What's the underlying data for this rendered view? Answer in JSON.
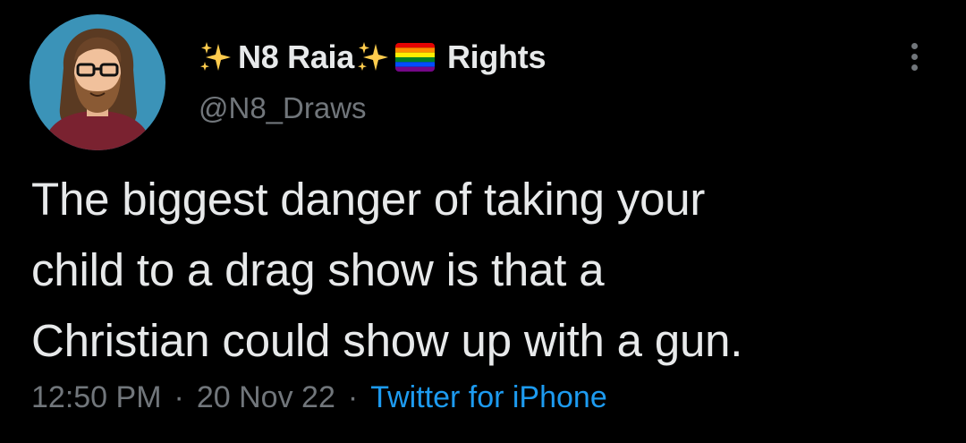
{
  "tweet": {
    "display_name": "N8 Raia",
    "display_name_suffix": "Rights",
    "handle": "@N8_Draws",
    "text": "The biggest danger of taking your\nchild to a drag show is that a\nChristian could show up with a gun.",
    "time": "12:50 PM",
    "separator": "·",
    "date": "20 Nov 22",
    "source": "Twitter for iPhone"
  },
  "icons": {
    "avatar": "bearded-man-avatar-icon",
    "sparkle": "sparkles-icon",
    "flag": "rainbow-flag-icon",
    "more": "more-vertical-icon"
  },
  "colors": {
    "background": "#000000",
    "primary_text": "#e7e9ea",
    "secondary_text": "#71767b",
    "link": "#1d9bf0"
  }
}
